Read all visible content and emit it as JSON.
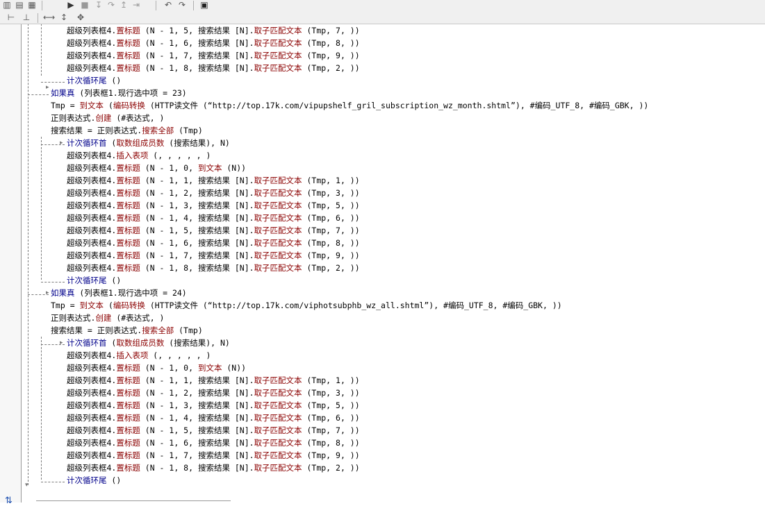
{
  "toolbar": {
    "row1_icons": [
      "layout-split-icon",
      "layout-top-icon",
      "layout-grid-icon",
      "run-icon",
      "stop-icon",
      "step-into-icon",
      "step-over-icon",
      "step-out-icon",
      "run-to-cursor-icon",
      "undo-icon",
      "redo-icon",
      "save-icon"
    ],
    "row2_icons": [
      "align-left-icon",
      "align-center-icon",
      "width-equal-icon",
      "height-equal-icon",
      "size-equal-icon"
    ]
  },
  "editor": {
    "lines": [
      {
        "indent": 2,
        "parts": [
          {
            "t": "超级列表框4."
          },
          {
            "t": "置标题",
            "c": "fn"
          },
          {
            "t": " (N - 1, 5, 搜索结果 [N]."
          },
          {
            "t": "取子匹配文本",
            "c": "fn"
          },
          {
            "t": " (Tmp, 7, ))"
          }
        ]
      },
      {
        "indent": 2,
        "parts": [
          {
            "t": "超级列表框4."
          },
          {
            "t": "置标题",
            "c": "fn"
          },
          {
            "t": " (N - 1, 6, 搜索结果 [N]."
          },
          {
            "t": "取子匹配文本",
            "c": "fn"
          },
          {
            "t": " (Tmp, 8, ))"
          }
        ]
      },
      {
        "indent": 2,
        "parts": [
          {
            "t": "超级列表框4."
          },
          {
            "t": "置标题",
            "c": "fn"
          },
          {
            "t": " (N - 1, 7, 搜索结果 [N]."
          },
          {
            "t": "取子匹配文本",
            "c": "fn"
          },
          {
            "t": " (Tmp, 9, ))"
          }
        ]
      },
      {
        "indent": 2,
        "parts": [
          {
            "t": "超级列表框4."
          },
          {
            "t": "置标题",
            "c": "fn"
          },
          {
            "t": " (N - 1, 8, 搜索结果 [N]."
          },
          {
            "t": "取子匹配文本",
            "c": "fn"
          },
          {
            "t": " (Tmp, 2, ))"
          }
        ]
      },
      {
        "indent": 2,
        "parts": [
          {
            "t": "计次循环尾",
            "c": "kw"
          },
          {
            "t": " ()"
          }
        ]
      },
      {
        "indent": 1,
        "parts": [
          {
            "t": "如果真",
            "c": "kw"
          },
          {
            "t": " (列表框1.现行选中项 = 23)"
          }
        ]
      },
      {
        "indent": 1,
        "parts": [
          {
            "t": "Tmp = "
          },
          {
            "t": "到文本",
            "c": "fn"
          },
          {
            "t": " ("
          },
          {
            "t": "编码转换",
            "c": "fn"
          },
          {
            "t": " (HTTP读文件 (“http://top.17k.com/vipupshelf_gril_subscription_wz_month.shtml”), #编码_UTF_8, #编码_GBK, ))"
          }
        ]
      },
      {
        "indent": 1,
        "parts": [
          {
            "t": "正则表达式."
          },
          {
            "t": "创建",
            "c": "fn"
          },
          {
            "t": " (#表达式, )"
          }
        ]
      },
      {
        "indent": 1,
        "parts": [
          {
            "t": "搜索结果 = 正则表达式."
          },
          {
            "t": "搜索全部",
            "c": "fn"
          },
          {
            "t": " (Tmp)"
          }
        ]
      },
      {
        "indent": 2,
        "parts": [
          {
            "t": "计次循环首",
            "c": "kw"
          },
          {
            "t": " ("
          },
          {
            "t": "取数组成员数",
            "c": "fn"
          },
          {
            "t": " (搜索结果), N)"
          }
        ]
      },
      {
        "indent": 2,
        "parts": [
          {
            "t": "超级列表框4."
          },
          {
            "t": "插入表项",
            "c": "fn"
          },
          {
            "t": " (, , , , , )"
          }
        ]
      },
      {
        "indent": 2,
        "parts": [
          {
            "t": "超级列表框4."
          },
          {
            "t": "置标题",
            "c": "fn"
          },
          {
            "t": " (N - 1, 0, "
          },
          {
            "t": "到文本",
            "c": "fn"
          },
          {
            "t": " (N))"
          }
        ]
      },
      {
        "indent": 2,
        "parts": [
          {
            "t": "超级列表框4."
          },
          {
            "t": "置标题",
            "c": "fn"
          },
          {
            "t": " (N - 1, 1, 搜索结果 [N]."
          },
          {
            "t": "取子匹配文本",
            "c": "fn"
          },
          {
            "t": " (Tmp, 1, ))"
          }
        ]
      },
      {
        "indent": 2,
        "parts": [
          {
            "t": "超级列表框4."
          },
          {
            "t": "置标题",
            "c": "fn"
          },
          {
            "t": " (N - 1, 2, 搜索结果 [N]."
          },
          {
            "t": "取子匹配文本",
            "c": "fn"
          },
          {
            "t": " (Tmp, 3, ))"
          }
        ]
      },
      {
        "indent": 2,
        "parts": [
          {
            "t": "超级列表框4."
          },
          {
            "t": "置标题",
            "c": "fn"
          },
          {
            "t": " (N - 1, 3, 搜索结果 [N]."
          },
          {
            "t": "取子匹配文本",
            "c": "fn"
          },
          {
            "t": " (Tmp, 5, ))"
          }
        ]
      },
      {
        "indent": 2,
        "parts": [
          {
            "t": "超级列表框4."
          },
          {
            "t": "置标题",
            "c": "fn"
          },
          {
            "t": " (N - 1, 4, 搜索结果 [N]."
          },
          {
            "t": "取子匹配文本",
            "c": "fn"
          },
          {
            "t": " (Tmp, 6, ))"
          }
        ]
      },
      {
        "indent": 2,
        "parts": [
          {
            "t": "超级列表框4."
          },
          {
            "t": "置标题",
            "c": "fn"
          },
          {
            "t": " (N - 1, 5, 搜索结果 [N]."
          },
          {
            "t": "取子匹配文本",
            "c": "fn"
          },
          {
            "t": " (Tmp, 7, ))"
          }
        ]
      },
      {
        "indent": 2,
        "parts": [
          {
            "t": "超级列表框4."
          },
          {
            "t": "置标题",
            "c": "fn"
          },
          {
            "t": " (N - 1, 6, 搜索结果 [N]."
          },
          {
            "t": "取子匹配文本",
            "c": "fn"
          },
          {
            "t": " (Tmp, 8, ))"
          }
        ]
      },
      {
        "indent": 2,
        "parts": [
          {
            "t": "超级列表框4."
          },
          {
            "t": "置标题",
            "c": "fn"
          },
          {
            "t": " (N - 1, 7, 搜索结果 [N]."
          },
          {
            "t": "取子匹配文本",
            "c": "fn"
          },
          {
            "t": " (Tmp, 9, ))"
          }
        ]
      },
      {
        "indent": 2,
        "parts": [
          {
            "t": "超级列表框4."
          },
          {
            "t": "置标题",
            "c": "fn"
          },
          {
            "t": " (N - 1, 8, 搜索结果 [N]."
          },
          {
            "t": "取子匹配文本",
            "c": "fn"
          },
          {
            "t": " (Tmp, 2, ))"
          }
        ]
      },
      {
        "indent": 2,
        "parts": [
          {
            "t": "计次循环尾",
            "c": "kw"
          },
          {
            "t": " ()"
          }
        ]
      },
      {
        "indent": 1,
        "parts": [
          {
            "t": "如果真",
            "c": "kw"
          },
          {
            "t": " (列表框1.现行选中项 = 24)"
          }
        ]
      },
      {
        "indent": 1,
        "parts": [
          {
            "t": "Tmp = "
          },
          {
            "t": "到文本",
            "c": "fn"
          },
          {
            "t": " ("
          },
          {
            "t": "编码转换",
            "c": "fn"
          },
          {
            "t": " (HTTP读文件 (“http://top.17k.com/viphotsubphb_wz_all.shtml”), #编码_UTF_8, #编码_GBK, ))"
          }
        ]
      },
      {
        "indent": 1,
        "parts": [
          {
            "t": "正则表达式."
          },
          {
            "t": "创建",
            "c": "fn"
          },
          {
            "t": " (#表达式, )"
          }
        ]
      },
      {
        "indent": 1,
        "parts": [
          {
            "t": "搜索结果 = 正则表达式."
          },
          {
            "t": "搜索全部",
            "c": "fn"
          },
          {
            "t": " (Tmp)"
          }
        ]
      },
      {
        "indent": 2,
        "parts": [
          {
            "t": "计次循环首",
            "c": "kw"
          },
          {
            "t": " ("
          },
          {
            "t": "取数组成员数",
            "c": "fn"
          },
          {
            "t": " (搜索结果), N)"
          }
        ]
      },
      {
        "indent": 2,
        "parts": [
          {
            "t": "超级列表框4."
          },
          {
            "t": "插入表项",
            "c": "fn"
          },
          {
            "t": " (, , , , , )"
          }
        ]
      },
      {
        "indent": 2,
        "parts": [
          {
            "t": "超级列表框4."
          },
          {
            "t": "置标题",
            "c": "fn"
          },
          {
            "t": " (N - 1, 0, "
          },
          {
            "t": "到文本",
            "c": "fn"
          },
          {
            "t": " (N))"
          }
        ]
      },
      {
        "indent": 2,
        "parts": [
          {
            "t": "超级列表框4."
          },
          {
            "t": "置标题",
            "c": "fn"
          },
          {
            "t": " (N - 1, 1, 搜索结果 [N]."
          },
          {
            "t": "取子匹配文本",
            "c": "fn"
          },
          {
            "t": " (Tmp, 1, ))"
          }
        ]
      },
      {
        "indent": 2,
        "parts": [
          {
            "t": "超级列表框4."
          },
          {
            "t": "置标题",
            "c": "fn"
          },
          {
            "t": " (N - 1, 2, 搜索结果 [N]."
          },
          {
            "t": "取子匹配文本",
            "c": "fn"
          },
          {
            "t": " (Tmp, 3, ))"
          }
        ]
      },
      {
        "indent": 2,
        "parts": [
          {
            "t": "超级列表框4."
          },
          {
            "t": "置标题",
            "c": "fn"
          },
          {
            "t": " (N - 1, 3, 搜索结果 [N]."
          },
          {
            "t": "取子匹配文本",
            "c": "fn"
          },
          {
            "t": " (Tmp, 5, ))"
          }
        ]
      },
      {
        "indent": 2,
        "parts": [
          {
            "t": "超级列表框4."
          },
          {
            "t": "置标题",
            "c": "fn"
          },
          {
            "t": " (N - 1, 4, 搜索结果 [N]."
          },
          {
            "t": "取子匹配文本",
            "c": "fn"
          },
          {
            "t": " (Tmp, 6, ))"
          }
        ]
      },
      {
        "indent": 2,
        "parts": [
          {
            "t": "超级列表框4."
          },
          {
            "t": "置标题",
            "c": "fn"
          },
          {
            "t": " (N - 1, 5, 搜索结果 [N]."
          },
          {
            "t": "取子匹配文本",
            "c": "fn"
          },
          {
            "t": " (Tmp, 7, ))"
          }
        ]
      },
      {
        "indent": 2,
        "parts": [
          {
            "t": "超级列表框4."
          },
          {
            "t": "置标题",
            "c": "fn"
          },
          {
            "t": " (N - 1, 6, 搜索结果 [N]."
          },
          {
            "t": "取子匹配文本",
            "c": "fn"
          },
          {
            "t": " (Tmp, 8, ))"
          }
        ]
      },
      {
        "indent": 2,
        "parts": [
          {
            "t": "超级列表框4."
          },
          {
            "t": "置标题",
            "c": "fn"
          },
          {
            "t": " (N - 1, 7, 搜索结果 [N]."
          },
          {
            "t": "取子匹配文本",
            "c": "fn"
          },
          {
            "t": " (Tmp, 9, ))"
          }
        ]
      },
      {
        "indent": 2,
        "parts": [
          {
            "t": "超级列表框4."
          },
          {
            "t": "置标题",
            "c": "fn"
          },
          {
            "t": " (N - 1, 8, 搜索结果 [N]."
          },
          {
            "t": "取子匹配文本",
            "c": "fn"
          },
          {
            "t": " (Tmp, 2, ))"
          }
        ]
      },
      {
        "indent": 2,
        "parts": [
          {
            "t": "计次循环尾",
            "c": "kw"
          },
          {
            "t": " ()"
          }
        ]
      }
    ]
  },
  "colors": {
    "function": "#8b0000",
    "keyword": "#00008b",
    "text": "#000000"
  }
}
